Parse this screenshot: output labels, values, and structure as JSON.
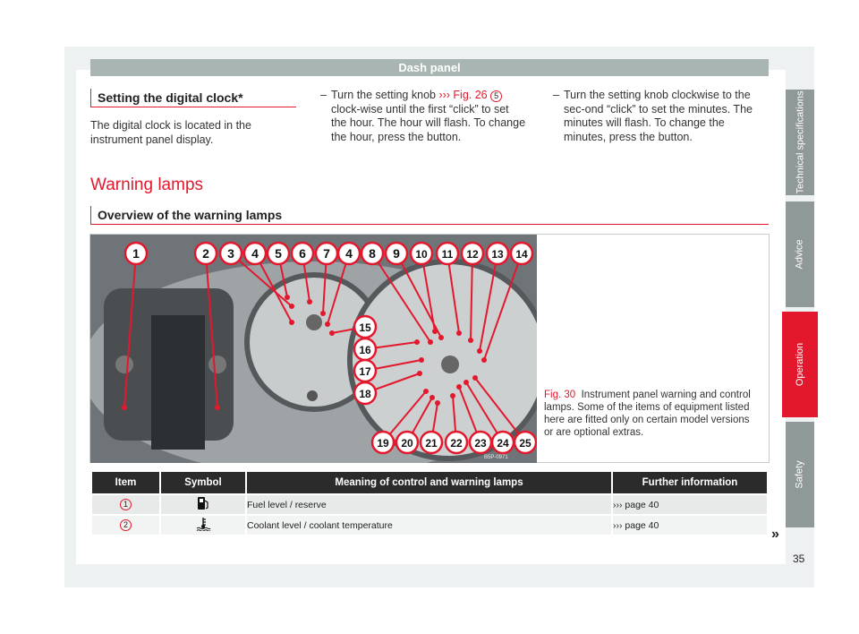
{
  "header": {
    "title": "Dash panel"
  },
  "clock": {
    "heading": "Setting the digital clock*",
    "intro": "The digital clock is located in the instrument panel display.",
    "step1_pre": "Turn the setting knob ",
    "step1_ref": "››› Fig. 26",
    "step1_num": "5",
    "step1_post": " clock-wise until the first “click” to set the hour. The hour will flash. To change the hour, press the button.",
    "step2": "Turn the setting knob clockwise to the sec-ond “click” to set the minutes. The minutes will flash. To change the minutes, press the button.",
    "dash": "–"
  },
  "warning": {
    "title": "Warning lamps",
    "subtitle": "Overview of the warning lamps"
  },
  "figure": {
    "label": "Fig. 30",
    "caption": "Instrument panel warning and control lamps. Some of the items of equipment listed here are fitted only on certain model versions or are optional extras.",
    "code": "B5P-0971",
    "callouts": [
      "1",
      "2",
      "3",
      "4",
      "5",
      "6",
      "7",
      "4",
      "8",
      "9",
      "10",
      "11",
      "12",
      "13",
      "14",
      "15",
      "16",
      "17",
      "18",
      "19",
      "20",
      "21",
      "22",
      "23",
      "24",
      "25"
    ],
    "colors": {
      "callout": "#e3182d",
      "gauge": "#a4a8aa"
    }
  },
  "table": {
    "headers": [
      "Item",
      "Symbol",
      "Meaning of control and warning lamps",
      "Further information"
    ],
    "rows": [
      {
        "item": "1",
        "symbol": "fuel-pump-icon",
        "meaning": "Fuel level / reserve",
        "info": "››› page 40"
      },
      {
        "item": "2",
        "symbol": "coolant-temperature-icon",
        "meaning": "Coolant level / coolant temperature",
        "info": "››› page 40"
      }
    ],
    "continue": "»"
  },
  "tabs": [
    "Technical specifications",
    "Advice",
    "Operation",
    "Safety"
  ],
  "active_tab": "Operation",
  "page_number": "35",
  "accent": "#e3182d"
}
